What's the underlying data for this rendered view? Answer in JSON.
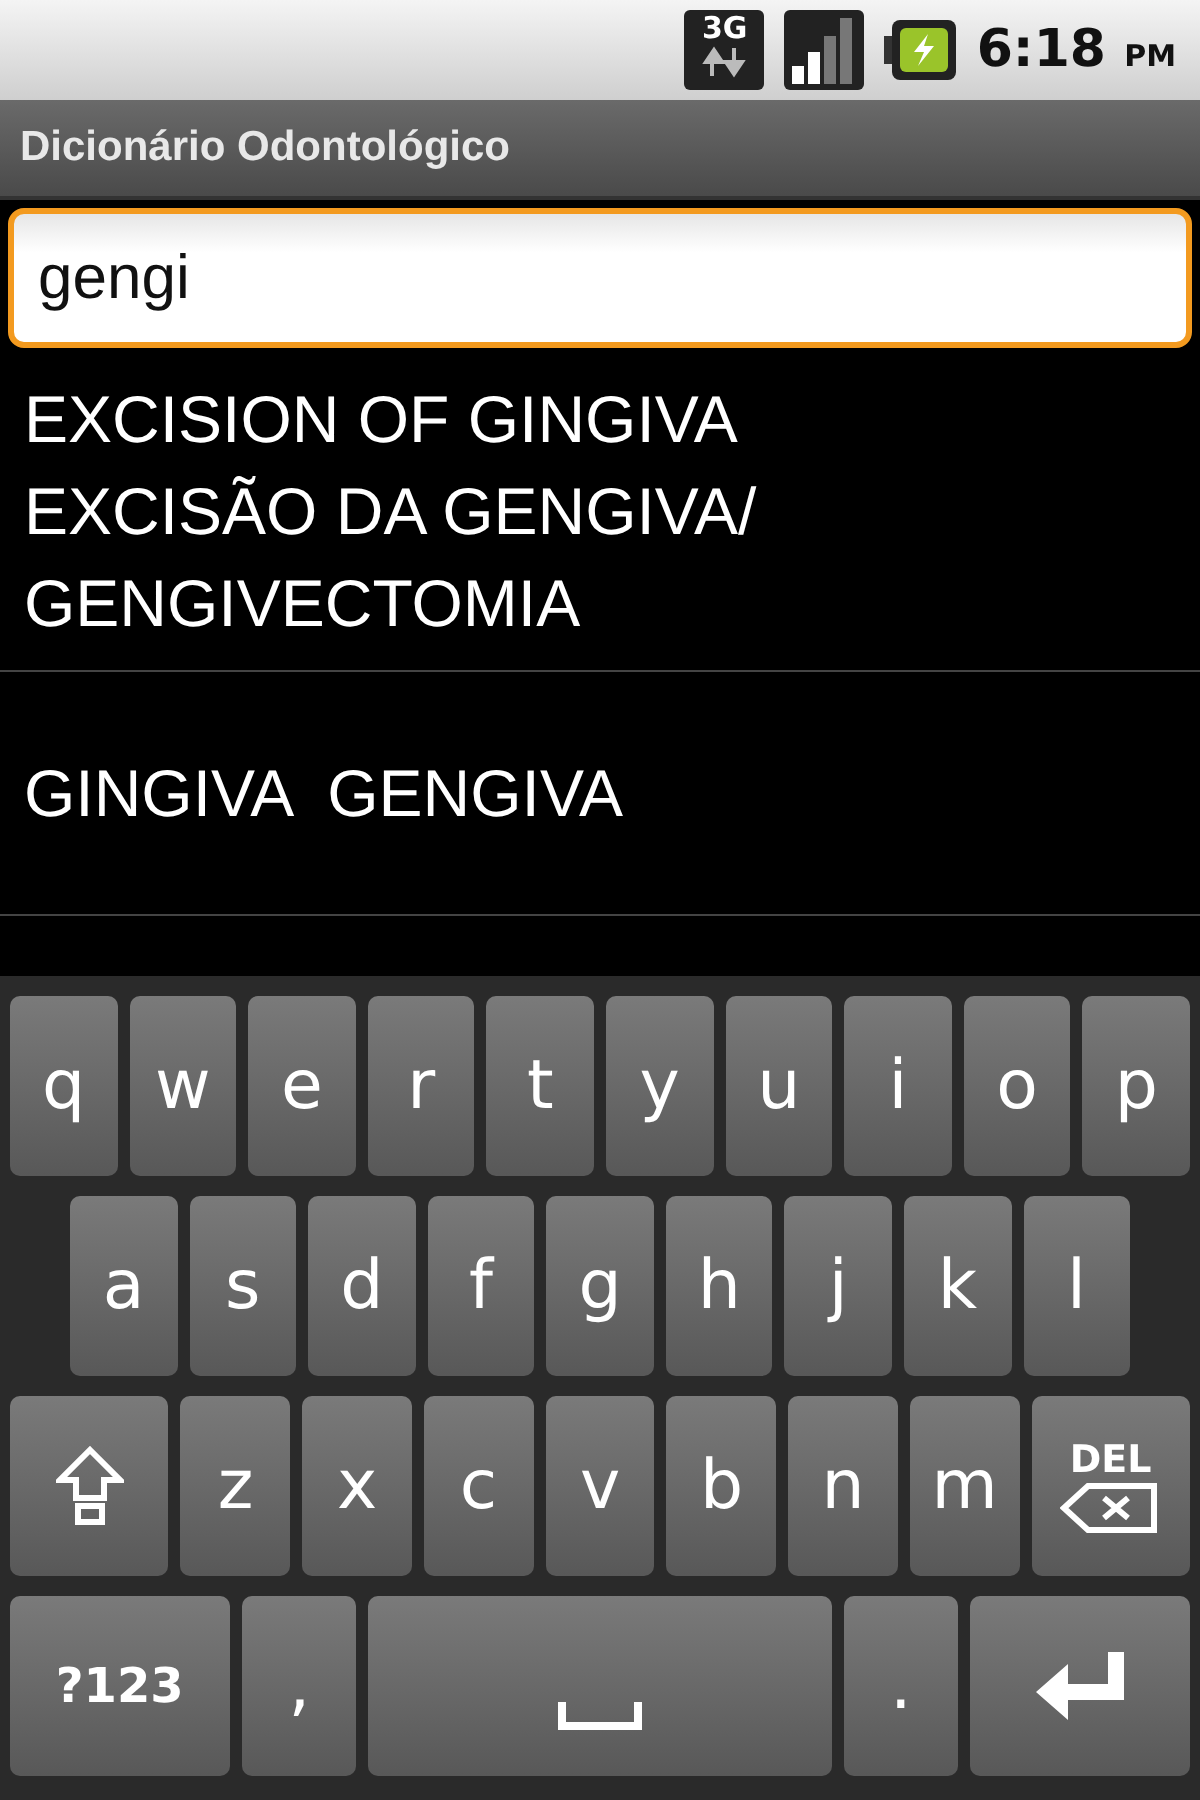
{
  "status_bar": {
    "network_type": "3G",
    "time": "6:18",
    "period": "PM"
  },
  "app_title": "Dicionário Odontológico",
  "search": {
    "value": "gengi"
  },
  "results": [
    {
      "text": "EXCISION OF GINGIVA\nEXCISÃO DA GENGIVA/\nGENGIVECTOMIA"
    },
    {
      "text": "GINGIVA  GENGIVA"
    }
  ],
  "keyboard": {
    "rows": [
      [
        {
          "kind": "char",
          "label": "q"
        },
        {
          "kind": "char",
          "label": "w"
        },
        {
          "kind": "char",
          "label": "e"
        },
        {
          "kind": "char",
          "label": "r"
        },
        {
          "kind": "char",
          "label": "t"
        },
        {
          "kind": "char",
          "label": "y"
        },
        {
          "kind": "char",
          "label": "u"
        },
        {
          "kind": "char",
          "label": "i"
        },
        {
          "kind": "char",
          "label": "o"
        },
        {
          "kind": "char",
          "label": "p"
        }
      ],
      [
        {
          "kind": "char",
          "label": "a"
        },
        {
          "kind": "char",
          "label": "s"
        },
        {
          "kind": "char",
          "label": "d"
        },
        {
          "kind": "char",
          "label": "f"
        },
        {
          "kind": "char",
          "label": "g"
        },
        {
          "kind": "char",
          "label": "h"
        },
        {
          "kind": "char",
          "label": "j"
        },
        {
          "kind": "char",
          "label": "k"
        },
        {
          "kind": "char",
          "label": "l"
        }
      ],
      [
        {
          "kind": "shift"
        },
        {
          "kind": "char",
          "label": "z"
        },
        {
          "kind": "char",
          "label": "x"
        },
        {
          "kind": "char",
          "label": "c"
        },
        {
          "kind": "char",
          "label": "v"
        },
        {
          "kind": "char",
          "label": "b"
        },
        {
          "kind": "char",
          "label": "n"
        },
        {
          "kind": "char",
          "label": "m"
        },
        {
          "kind": "del",
          "label": "DEL"
        }
      ],
      [
        {
          "kind": "symbols",
          "label": "?123"
        },
        {
          "kind": "char",
          "label": ","
        },
        {
          "kind": "space"
        },
        {
          "kind": "char",
          "label": "."
        },
        {
          "kind": "enter"
        }
      ]
    ]
  }
}
